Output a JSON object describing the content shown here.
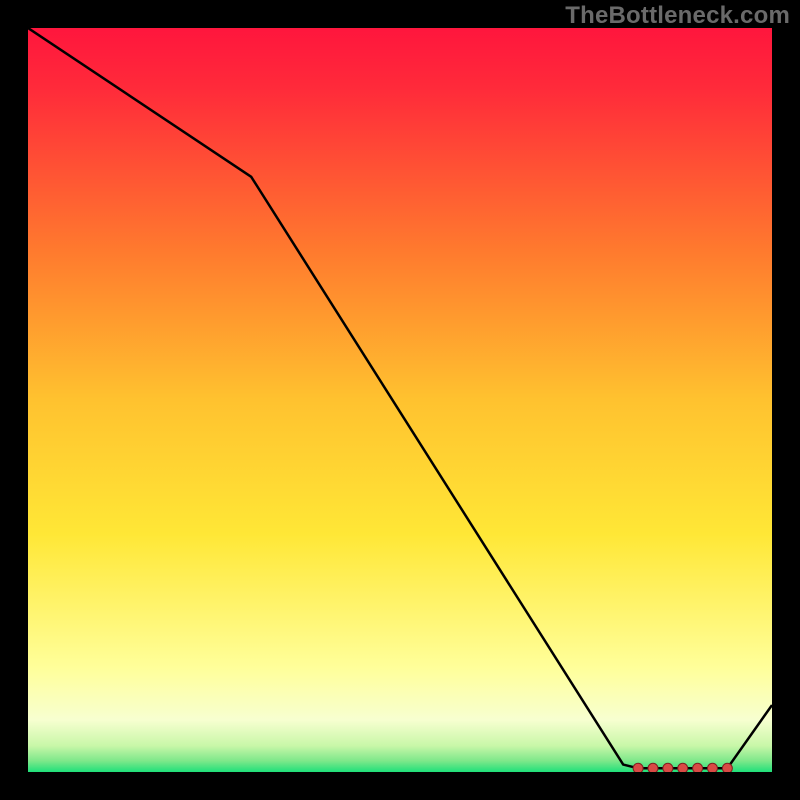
{
  "watermark": "TheBottleneck.com",
  "colors": {
    "background": "#000000",
    "line": "#000000",
    "marker": "#d94a45",
    "gradient_top": "#ff1a3a",
    "gradient_upper_mid": "#ff9a2a",
    "gradient_mid": "#ffe736",
    "gradient_lower": "#ffffb0",
    "gradient_bottom": "#1fe07a"
  },
  "chart_data": {
    "type": "line",
    "title": "",
    "xlabel": "",
    "ylabel": "",
    "xlim": [
      0,
      100
    ],
    "ylim": [
      0,
      100
    ],
    "x": [
      0,
      30,
      80,
      82,
      84,
      86,
      88,
      90,
      92,
      94,
      100
    ],
    "values": [
      100,
      80,
      1,
      0.5,
      0.5,
      0.5,
      0.5,
      0.5,
      0.5,
      0.5,
      9
    ],
    "marker_indices": [
      3,
      4,
      5,
      6,
      7,
      8,
      9
    ]
  }
}
